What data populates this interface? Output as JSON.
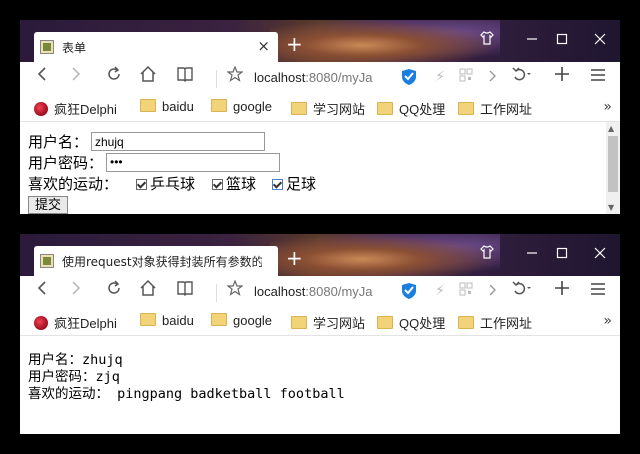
{
  "window1": {
    "tab_title": "表单",
    "url_host": "localhost",
    "url_rest": ":8080/myJa",
    "bookmarks": [
      "疯狂Delphi",
      "baidu",
      "google",
      "学习网站",
      "QQ处理",
      "工作网址"
    ],
    "form": {
      "username_label": "用户名：",
      "username_value": "zhujq",
      "password_label": "用户密码：",
      "password_mask": "•••",
      "sports_label": "喜欢的运动：",
      "sports": [
        {
          "label": "乒乓球",
          "checked": true
        },
        {
          "label": "篮球",
          "checked": true
        },
        {
          "label": "足球",
          "checked": true
        }
      ],
      "submit_label": "提交"
    }
  },
  "window2": {
    "tab_title": "使用request对象获得封装所有参数的",
    "url_host": "localhost",
    "url_rest": ":8080/myJa",
    "bookmarks": [
      "疯狂Delphi",
      "baidu",
      "google",
      "学习网站",
      "QQ处理",
      "工作网址"
    ],
    "lines": [
      "用户名：zhujq",
      "用户密码：zjq",
      "喜欢的运动： pingpang badketball football"
    ]
  },
  "icons": {
    "new_tab": "+",
    "close": "×",
    "more": "»"
  }
}
